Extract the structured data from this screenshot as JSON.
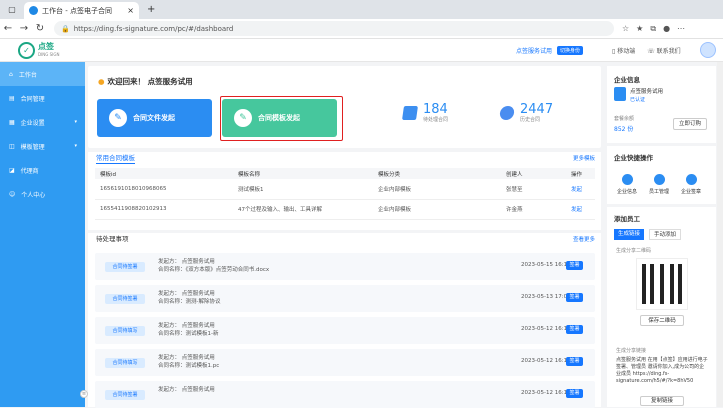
{
  "browser": {
    "tab_title": "工作台 - 点签电子合同",
    "url": "https://ding.fs-signature.com/pc/#/dashboard"
  },
  "header": {
    "logo_text": "点签",
    "logo_sub": "DING SIGN",
    "org_name": "点签服务试用",
    "org_switch": "切换身份",
    "mobile": "移动端",
    "contact": "联系我们"
  },
  "sidebar": {
    "items": [
      {
        "label": "工作台",
        "icon": "home-icon"
      },
      {
        "label": "合同管理",
        "icon": "document-icon"
      },
      {
        "label": "企业设置",
        "icon": "building-icon"
      },
      {
        "label": "模板管理",
        "icon": "template-icon"
      },
      {
        "label": "代理商",
        "icon": "agent-icon"
      },
      {
        "label": "个人中心",
        "icon": "user-icon"
      }
    ]
  },
  "welcome": {
    "title": "欢迎回来！ 点签服务试用",
    "card_file": "合同文件发起",
    "card_template": "合同模板发起",
    "stat_pending_num": "184",
    "stat_pending_label": "待处理合同",
    "stat_history_num": "2447",
    "stat_history_label": "历史合同"
  },
  "templates": {
    "title": "常用合同模板",
    "more": "更多模板",
    "headers": [
      "模板id",
      "模板名称",
      "模板分类",
      "创建人",
      "操作"
    ],
    "rows": [
      {
        "id": "1656191018010968065",
        "name": "测试模板1",
        "category": "企业内部模板",
        "creator": "张慧至",
        "action": "发起"
      },
      {
        "id": "1655411908820102913",
        "name": "47个过程及输入、输出、工具详解",
        "category": "企业内部模板",
        "creator": "许金燕",
        "action": "发起"
      }
    ]
  },
  "todo": {
    "title": "待处理事项",
    "more": "查看更多",
    "items": [
      {
        "btn": "合同待签署",
        "line1": "发起方：  点签服务试用",
        "line2": "合同名称：《双方本版》点签劳动合同书.docx",
        "date": "2023-05-15 16:19",
        "action": "签署"
      },
      {
        "btn": "合同待签署",
        "line1": "发起方：  点签服务试用",
        "line2": "合同名称：测测-解除协议",
        "date": "2023-05-13 17:04",
        "action": "签署"
      },
      {
        "btn": "合同待填写",
        "line1": "发起方：  点签服务试用",
        "line2": "合同名称：测试模板1-新",
        "date": "2023-05-12 16:17",
        "action": "签署"
      },
      {
        "btn": "合同待填写",
        "line1": "发起方：  点签服务试用",
        "line2": "合同名称：测试模板1.pc",
        "date": "2023-05-12 16:16",
        "action": "签署"
      },
      {
        "btn": "合同待签署",
        "line1": "发起方：  点签服务试用",
        "line2": "",
        "date": "2023-05-12 16:15",
        "action": "签署"
      }
    ]
  },
  "right": {
    "company_title": "企业信息",
    "company_name": "点签服务试用",
    "company_status": "已认证",
    "balance_label": "套餐余额",
    "balance_value": "852 份",
    "order_btn": "立即订购",
    "quick_title": "企业快捷操作",
    "quick_items": [
      "企业信息",
      "员工管理",
      "企业签章"
    ],
    "invite_title": "添加员工",
    "invite_tabs": [
      "生成链接",
      "手动添加"
    ],
    "qr_label": "生成分享二维码",
    "save_qr": "保存二维码",
    "link_label": "生成分享链接",
    "link_text": "点签服务试用 在用【点签】应用进行电子签署、管理员 邀请你加入,成为公司的企业成员 https://ding.fs-signature.com/h5/#/?k=8hV50",
    "copy_btn": "复制链接"
  }
}
